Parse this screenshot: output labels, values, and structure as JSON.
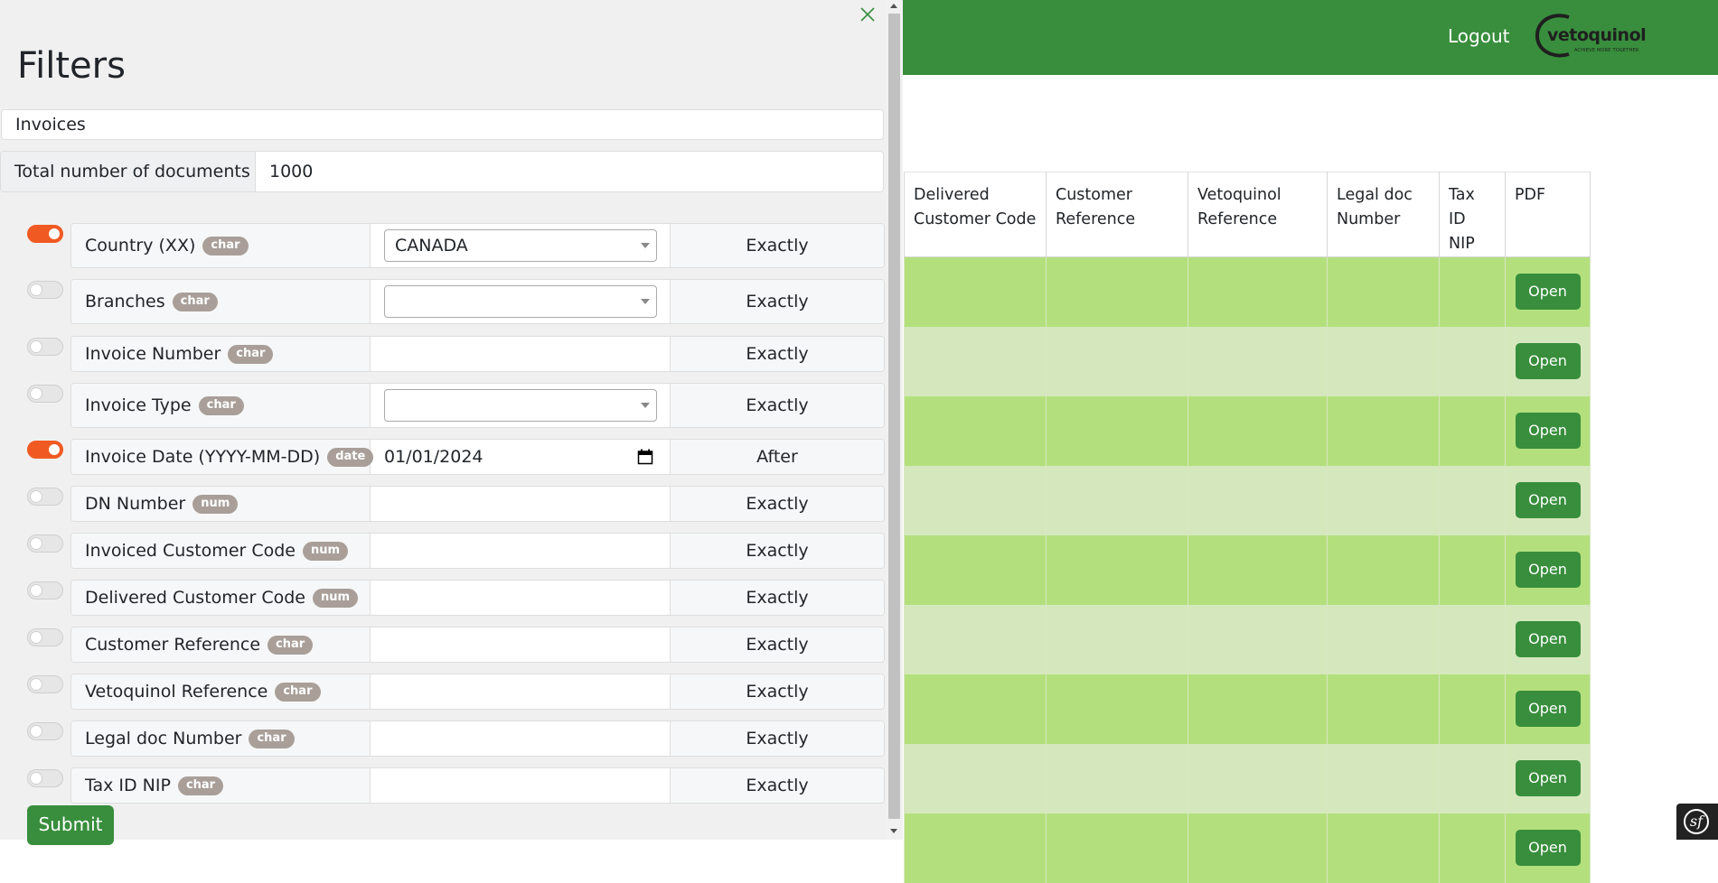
{
  "header": {
    "logout_label": "Logout",
    "brand": {
      "name": "vetoquinol",
      "tagline": "ACHIEVE MORE TOGETHER"
    },
    "colors": {
      "brand_green": "#388e3c"
    }
  },
  "results_table": {
    "columns": [
      "Delivered Customer Code",
      "Customer Reference",
      "Vetoquinol Reference",
      "Legal doc Number",
      "Tax ID NIP",
      "PDF"
    ],
    "rows": [
      {
        "delivered_customer_code": "",
        "customer_reference": "",
        "vetoquinol_reference": "",
        "legal_doc_number": "",
        "tax_id_nip": "",
        "pdf": "Open"
      },
      {
        "delivered_customer_code": "",
        "customer_reference": "",
        "vetoquinol_reference": "",
        "legal_doc_number": "",
        "tax_id_nip": "",
        "pdf": "Open"
      },
      {
        "delivered_customer_code": "",
        "customer_reference": "",
        "vetoquinol_reference": "",
        "legal_doc_number": "",
        "tax_id_nip": "",
        "pdf": "Open"
      },
      {
        "delivered_customer_code": "",
        "customer_reference": "",
        "vetoquinol_reference": "",
        "legal_doc_number": "",
        "tax_id_nip": "",
        "pdf": "Open"
      },
      {
        "delivered_customer_code": "",
        "customer_reference": "",
        "vetoquinol_reference": "",
        "legal_doc_number": "",
        "tax_id_nip": "",
        "pdf": "Open"
      },
      {
        "delivered_customer_code": "",
        "customer_reference": "",
        "vetoquinol_reference": "",
        "legal_doc_number": "",
        "tax_id_nip": "",
        "pdf": "Open"
      },
      {
        "delivered_customer_code": "",
        "customer_reference": "",
        "vetoquinol_reference": "",
        "legal_doc_number": "",
        "tax_id_nip": "",
        "pdf": "Open"
      },
      {
        "delivered_customer_code": "",
        "customer_reference": "",
        "vetoquinol_reference": "",
        "legal_doc_number": "",
        "tax_id_nip": "",
        "pdf": "Open"
      },
      {
        "delivered_customer_code": "",
        "customer_reference": "",
        "vetoquinol_reference": "",
        "legal_doc_number": "",
        "tax_id_nip": "",
        "pdf": "Open"
      }
    ]
  },
  "filters_panel": {
    "title": "Filters",
    "section": "Invoices",
    "total_label": "Total number of documents",
    "total_value": "1000",
    "submit_label": "Submit",
    "close_icon": "close-icon",
    "filters": [
      {
        "label": "Country (XX)",
        "type": "char",
        "enabled": true,
        "input_kind": "select",
        "value": "CANADA",
        "operator": "Exactly"
      },
      {
        "label": "Branches",
        "type": "char",
        "enabled": false,
        "input_kind": "select",
        "value": "",
        "operator": "Exactly"
      },
      {
        "label": "Invoice Number",
        "type": "char",
        "enabled": false,
        "input_kind": "text",
        "value": "",
        "operator": "Exactly"
      },
      {
        "label": "Invoice Type",
        "type": "char",
        "enabled": false,
        "input_kind": "select",
        "value": "",
        "operator": "Exactly"
      },
      {
        "label": "Invoice Date (YYYY-MM-DD)",
        "type": "date",
        "enabled": true,
        "input_kind": "date",
        "value": "01/01/2024",
        "operator": "After"
      },
      {
        "label": "DN Number",
        "type": "num",
        "enabled": false,
        "input_kind": "text",
        "value": "",
        "operator": "Exactly"
      },
      {
        "label": "Invoiced Customer Code",
        "type": "num",
        "enabled": false,
        "input_kind": "text",
        "value": "",
        "operator": "Exactly"
      },
      {
        "label": "Delivered Customer Code",
        "type": "num",
        "enabled": false,
        "input_kind": "text",
        "value": "",
        "operator": "Exactly"
      },
      {
        "label": "Customer Reference",
        "type": "char",
        "enabled": false,
        "input_kind": "text",
        "value": "",
        "operator": "Exactly"
      },
      {
        "label": "Vetoquinol Reference",
        "type": "char",
        "enabled": false,
        "input_kind": "text",
        "value": "",
        "operator": "Exactly"
      },
      {
        "label": "Legal doc Number",
        "type": "char",
        "enabled": false,
        "input_kind": "text",
        "value": "",
        "operator": "Exactly"
      },
      {
        "label": "Tax ID NIP",
        "type": "char",
        "enabled": false,
        "input_kind": "text",
        "value": "",
        "operator": "Exactly"
      }
    ],
    "colors": {
      "toggle_on": "#f05a22",
      "badge": "#a99f98"
    }
  }
}
